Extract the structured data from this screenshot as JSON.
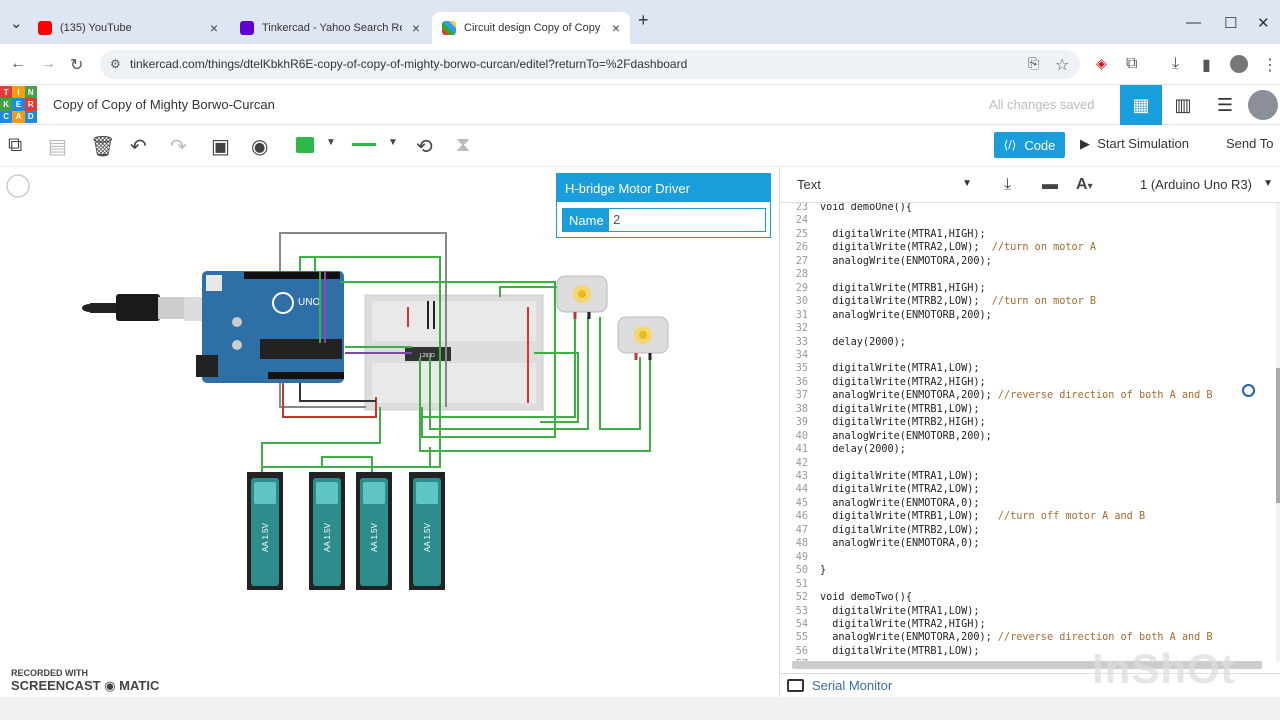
{
  "browser": {
    "tabs": [
      {
        "title": "(135) YouTube",
        "favicon_color": "#ff0000",
        "active": false
      },
      {
        "title": "Tinkercad - Yahoo Search Resul",
        "favicon_color": "#6001d2",
        "active": false
      },
      {
        "title": "Circuit design Copy of Copy of",
        "favicon_color": "#1a9edb",
        "active": true
      }
    ],
    "new_tab": "+",
    "url": "tinkercad.com/things/dtelKbkhR6E-copy-of-copy-of-mighty-borwo-curcan/editel?returnTo=%2Fdashboard"
  },
  "header": {
    "logo_letters": [
      "T",
      "I",
      "N",
      "K",
      "E",
      "R",
      "C",
      "A",
      "D"
    ],
    "title": "Copy of Copy of Mighty Borwo-Curcan",
    "saved_status": "All changes saved"
  },
  "toolbar": {
    "code_label": "Code",
    "simulate_label": "Start Simulation",
    "send_label": "Send To"
  },
  "inspector": {
    "title": "H-bridge Motor Driver",
    "name_label": "Name",
    "name_value": "2"
  },
  "canvas_labels": {
    "arduino": "UNO",
    "battery": "AA 1.5V",
    "chip": "L293D"
  },
  "code_panel": {
    "mode": "Text",
    "device": "1 (Arduino Uno R3)",
    "lines": [
      {
        "n": "23",
        "code": "void demoOne(){",
        "comment": ""
      },
      {
        "n": "24",
        "code": "",
        "comment": ""
      },
      {
        "n": "25",
        "code": "  digitalWrite(MTRA1,HIGH);",
        "comment": ""
      },
      {
        "n": "26",
        "code": "  digitalWrite(MTRA2,LOW);  ",
        "comment": "//turn on motor A"
      },
      {
        "n": "27",
        "code": "  analogWrite(ENMOTORA,200);",
        "comment": ""
      },
      {
        "n": "28",
        "code": "",
        "comment": ""
      },
      {
        "n": "29",
        "code": "  digitalWrite(MTRB1,HIGH);",
        "comment": ""
      },
      {
        "n": "30",
        "code": "  digitalWrite(MTRB2,LOW);  ",
        "comment": "//turn on motor B"
      },
      {
        "n": "31",
        "code": "  analogWrite(ENMOTORB,200);",
        "comment": ""
      },
      {
        "n": "32",
        "code": "",
        "comment": ""
      },
      {
        "n": "33",
        "code": "  delay(2000);",
        "comment": ""
      },
      {
        "n": "34",
        "code": "",
        "comment": ""
      },
      {
        "n": "35",
        "code": "  digitalWrite(MTRA1,LOW);",
        "comment": ""
      },
      {
        "n": "36",
        "code": "  digitalWrite(MTRA2,HIGH);",
        "comment": ""
      },
      {
        "n": "37",
        "code": "  analogWrite(ENMOTORA,200); ",
        "comment": "//reverse direction of both A and B"
      },
      {
        "n": "38",
        "code": "  digitalWrite(MTRB1,LOW);",
        "comment": ""
      },
      {
        "n": "39",
        "code": "  digitalWrite(MTRB2,HIGH);",
        "comment": ""
      },
      {
        "n": "40",
        "code": "  analogWrite(ENMOTORB,200);",
        "comment": ""
      },
      {
        "n": "41",
        "code": "  delay(2000);",
        "comment": ""
      },
      {
        "n": "42",
        "code": "",
        "comment": ""
      },
      {
        "n": "43",
        "code": "  digitalWrite(MTRA1,LOW);",
        "comment": ""
      },
      {
        "n": "44",
        "code": "  digitalWrite(MTRA2,LOW);",
        "comment": ""
      },
      {
        "n": "45",
        "code": "  analogWrite(ENMOTORA,0);",
        "comment": ""
      },
      {
        "n": "46",
        "code": "  digitalWrite(MTRB1,LOW);   ",
        "comment": "//turn off motor A and B"
      },
      {
        "n": "47",
        "code": "  digitalWrite(MTRB2,LOW);",
        "comment": ""
      },
      {
        "n": "48",
        "code": "  analogWrite(ENMOTORA,0);",
        "comment": ""
      },
      {
        "n": "49",
        "code": "",
        "comment": ""
      },
      {
        "n": "50",
        "code": "}",
        "comment": ""
      },
      {
        "n": "51",
        "code": "",
        "comment": ""
      },
      {
        "n": "52",
        "code": "void demoTwo(){",
        "comment": ""
      },
      {
        "n": "53",
        "code": "  digitalWrite(MTRA1,LOW);",
        "comment": ""
      },
      {
        "n": "54",
        "code": "  digitalWrite(MTRA2,HIGH);",
        "comment": ""
      },
      {
        "n": "55",
        "code": "  analogWrite(ENMOTORA,200); ",
        "comment": "//reverse direction of both A and B"
      },
      {
        "n": "56",
        "code": "  digitalWrite(MTRB1,LOW);",
        "comment": ""
      },
      {
        "n": "57",
        "code": "",
        "comment": ""
      }
    ],
    "serial_monitor": "Serial Monitor"
  },
  "overlays": {
    "recorded_with": "RECORDED WITH",
    "screencast": "SCREENCAST",
    "matic": "MATIC",
    "inshot": "InShOt"
  },
  "colors": {
    "accent": "#1a9edb",
    "component_green": "#2eb84b",
    "wire_green": "#3cb043",
    "battery": "#2d8c8c",
    "arduino": "#2f6fa8"
  }
}
